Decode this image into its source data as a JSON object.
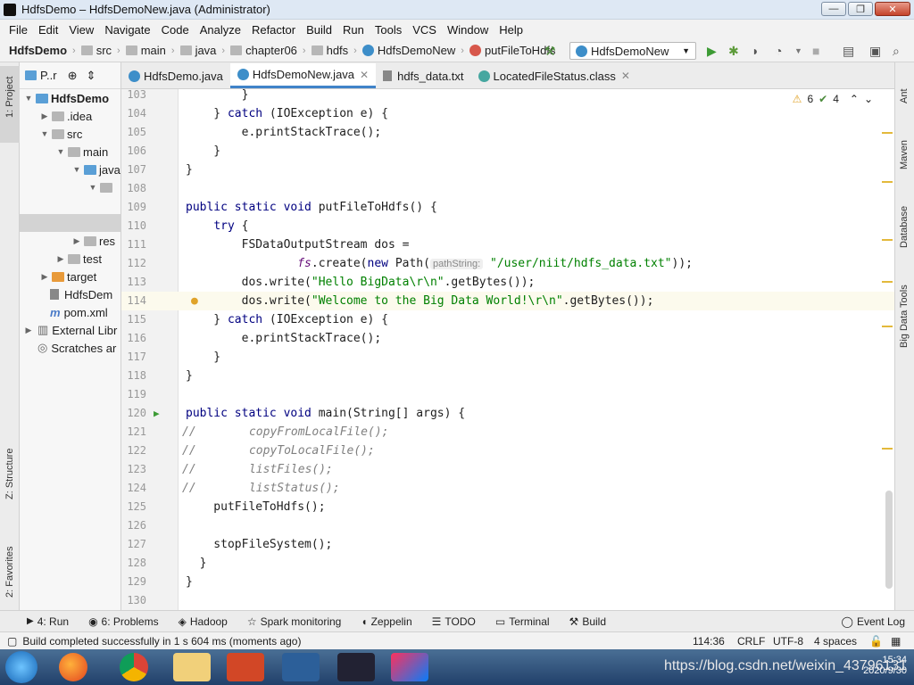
{
  "window": {
    "title": "HdfsDemo – HdfsDemoNew.java (Administrator)",
    "min": "—",
    "max": "❐",
    "close": "✕"
  },
  "menu": [
    "File",
    "Edit",
    "View",
    "Navigate",
    "Code",
    "Analyze",
    "Refactor",
    "Build",
    "Run",
    "Tools",
    "VCS",
    "Window",
    "Help"
  ],
  "breadcrumb": {
    "project": "HdfsDemo",
    "p1": "src",
    "p2": "main",
    "p3": "java",
    "p4": "chapter06",
    "p5": "hdfs",
    "cls": "HdfsDemoNew",
    "method": "putFileToHdfs"
  },
  "run_config": "HdfsDemoNew",
  "left_strip": {
    "project": "1: Project",
    "structure": "Z: Structure",
    "favorites": "2: Favorites"
  },
  "project_panel": {
    "title": "P..r",
    "tree": [
      {
        "label": "HdfsDemo"
      },
      {
        "label": ".idea"
      },
      {
        "label": "src"
      },
      {
        "label": "main"
      },
      {
        "label": "java"
      },
      {
        "label": ""
      },
      {
        "label": "res"
      },
      {
        "label": "test"
      },
      {
        "label": "target"
      },
      {
        "label": "HdfsDem"
      },
      {
        "label": "pom.xml"
      },
      {
        "label": "External Libr"
      },
      {
        "label": "Scratches ar"
      }
    ]
  },
  "tabs": [
    {
      "label": "HdfsDemo.java"
    },
    {
      "label": "HdfsDemoNew.java"
    },
    {
      "label": "hdfs_data.txt"
    },
    {
      "label": "LocatedFileStatus.class"
    }
  ],
  "inspections": {
    "warnings": "6",
    "ok": "4"
  },
  "editor": {
    "line_numbers": [
      "103",
      "104",
      "105",
      "106",
      "107",
      "108",
      "109",
      "110",
      "111",
      "112",
      "113",
      "114",
      "115",
      "116",
      "117",
      "118",
      "119",
      "120",
      "121",
      "122",
      "123",
      "124",
      "125",
      "126",
      "127",
      "128",
      "129",
      "130"
    ],
    "code": {
      "l103": "        }",
      "l104a": "    } ",
      "l104b": "catch",
      "l104c": " (IOException e) {",
      "l105": "        e.printStackTrace();",
      "l106": "    }",
      "l107": "}",
      "l109a": "public static void",
      "l109b": " putFileToHdfs() {",
      "l110a": "    ",
      "l110b": "try",
      "l110c": " {",
      "l111": "        FSDataOutputStream dos =",
      "l112a": "                ",
      "l112b": "fs",
      "l112c": ".create(",
      "l112d": "new",
      "l112e": " Path(",
      "l112f": "pathString:",
      "l112g": " \"/user/niit/hdfs_data.txt\"",
      "l112h": "));",
      "l113a": "        dos.write(",
      "l113b": "\"Hello BigData\\r\\n\"",
      "l113c": ".getBytes());",
      "l114a": "        dos.write(",
      "l114b": "\"Welcome to the Big Data World!\\r\\n\"",
      "l114c": ".getBytes());",
      "l115a": "    } ",
      "l115b": "catch",
      "l115c": " (IOException e) {",
      "l116": "        e.printStackTrace();",
      "l117": "    }",
      "l118": "}",
      "l120a": "public static void",
      "l120b": " main(String[] args) {",
      "l121a": "//",
      "l121b": "      copyFromLocalFile();",
      "l122a": "//",
      "l122b": "      copyToLocalFile();",
      "l123a": "//",
      "l123b": "      listFiles();",
      "l124a": "//",
      "l124b": "      listStatus();",
      "l125": "    putFileToHdfs();",
      "l127": "    stopFileSystem();",
      "l128": "  }",
      "l129": "}"
    }
  },
  "right_strip": {
    "ant": "Ant",
    "maven": "Maven",
    "database": "Database",
    "bigdata": "Big Data Tools"
  },
  "bottom_tools": [
    "4: Run",
    "6: Problems",
    "Hadoop",
    "Spark monitoring",
    "Zeppelin",
    "TODO",
    "Terminal",
    "Build"
  ],
  "event_log": "Event Log",
  "status": {
    "message": "Build completed successfully in 1 s 604 ms (moments ago)",
    "pos": "114:36",
    "eol": "CRLF",
    "enc": "UTF-8",
    "indent": "4 spaces"
  },
  "taskbar": {
    "time": "15:34",
    "date": "2020/9/30",
    "watermark": "https://blog.csdn.net/weixin_43796131"
  }
}
